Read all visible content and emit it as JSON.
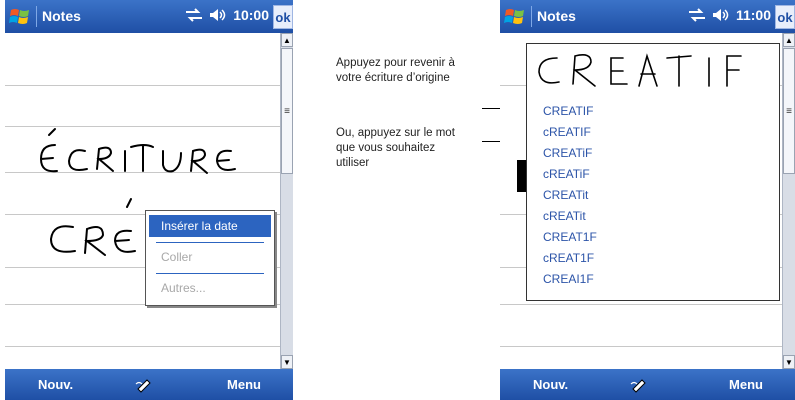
{
  "left_screen": {
    "app_title": "Notes",
    "status_icons": [
      "connectivity-icon",
      "speaker-icon"
    ],
    "time": "10:00",
    "ok_label": "ok",
    "menu": {
      "left": "Nouv.",
      "right": "Menu",
      "center_icon": "pen-icon"
    },
    "context_menu": {
      "items": [
        {
          "label": "Insérer la date",
          "state": "highlighted"
        },
        {
          "label": "Coller",
          "state": "disabled"
        },
        {
          "label": "Autres...",
          "state": "disabled"
        }
      ]
    }
  },
  "right_screen": {
    "app_title": "Notes",
    "time": "11:00",
    "ok_label": "ok",
    "menu": {
      "left": "Nouv.",
      "right": "Menu",
      "center_icon": "pen-icon"
    },
    "candidates": [
      "CREATIF",
      "cREATIF",
      "CREATiF",
      "cREATiF",
      "CREATit",
      "cREATit",
      "CREAT1F",
      "cREAT1F",
      "CREAI1F"
    ]
  },
  "callouts": {
    "original": "Appuyez pour revenir à votre écriture d’origine",
    "word": "Ou, appuyez sur le mot que vous souhaitez utiliser"
  },
  "colors": {
    "title_blue": "#1f4fa5",
    "highlight": "#2c64c0",
    "candidate_text": "#2c54a8"
  }
}
